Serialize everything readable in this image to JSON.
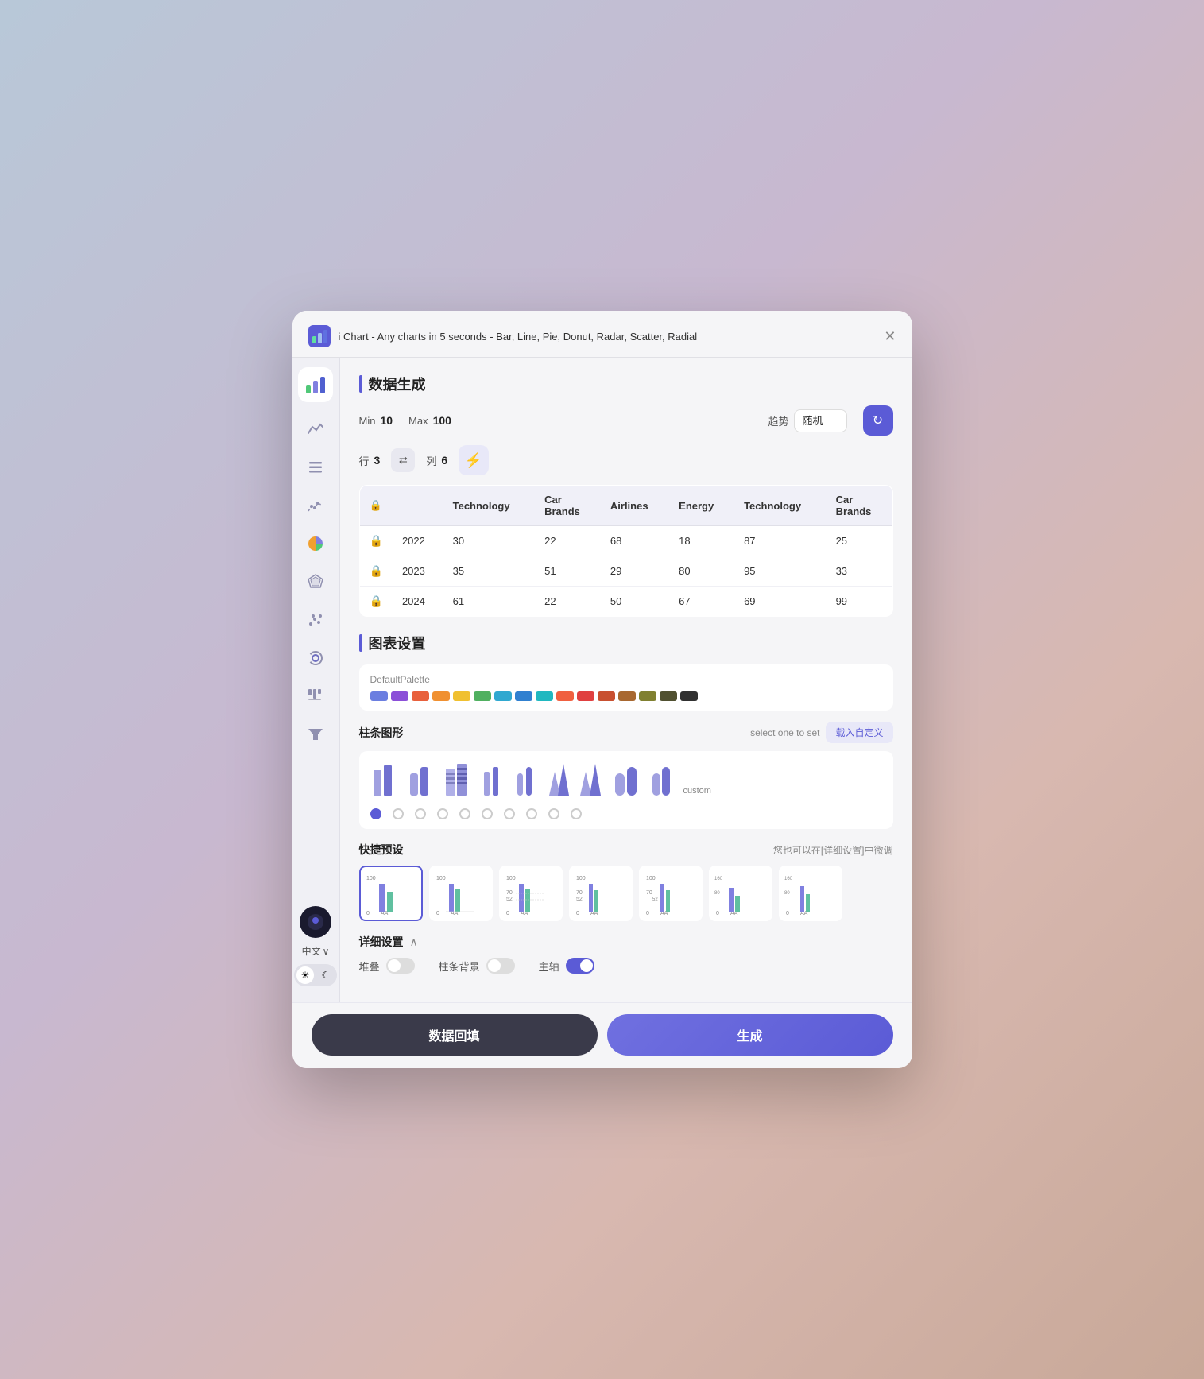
{
  "window": {
    "title": "i Chart - Any charts in 5 seconds - Bar, Line, Pie, Donut, Radar, Scatter, Radial",
    "close_label": "✕"
  },
  "sidebar": {
    "items": [
      {
        "icon": "📊",
        "name": "bar-chart"
      },
      {
        "icon": "〰",
        "name": "line-chart"
      },
      {
        "icon": "≡",
        "name": "list-chart"
      },
      {
        "icon": "⋯",
        "name": "scatter-chart"
      },
      {
        "icon": "◑",
        "name": "pie-chart"
      },
      {
        "icon": "⬡",
        "name": "radar-chart"
      },
      {
        "icon": "⋰",
        "name": "scatter2-chart"
      },
      {
        "icon": "◌",
        "name": "radial-chart"
      },
      {
        "icon": "⫶",
        "name": "grid-chart"
      },
      {
        "icon": "▽",
        "name": "funnel-chart"
      }
    ],
    "bottom": {
      "lang": "中文",
      "lang_arrow": "∨",
      "theme_sun": "☀",
      "theme_moon": "☾"
    }
  },
  "data_section": {
    "title": "数据生成",
    "min_label": "Min",
    "min_value": "10",
    "max_label": "Max",
    "max_value": "100",
    "trend_label": "趋势",
    "trend_value": "随机",
    "row_label": "行",
    "row_value": "3",
    "col_label": "列",
    "col_value": "6",
    "table": {
      "headers": [
        "",
        "",
        "Technology",
        "Car Brands",
        "Airlines",
        "Energy",
        "Technology",
        "Car Brands"
      ],
      "rows": [
        {
          "lock": "🔒",
          "year": "2022",
          "vals": [
            "30",
            "22",
            "68",
            "18",
            "87",
            "25"
          ]
        },
        {
          "lock": "🔒",
          "year": "2023",
          "vals": [
            "35",
            "51",
            "29",
            "80",
            "95",
            "33"
          ]
        },
        {
          "lock": "🔒",
          "year": "2024",
          "vals": [
            "61",
            "22",
            "50",
            "67",
            "69",
            "99"
          ]
        }
      ]
    }
  },
  "chart_section": {
    "title": "图表设置",
    "palette_name": "DefaultPalette",
    "palette_colors": [
      "#6b7ee0",
      "#8b4fd8",
      "#e8603c",
      "#f09030",
      "#f0c030",
      "#50b060",
      "#30a8d0",
      "#3080d0",
      "#20b8c0",
      "#f06040",
      "#e04040",
      "#c85030",
      "#a86830",
      "#808030",
      "#505030",
      "#303030"
    ],
    "bar_shape_label": "柱条图形",
    "select_hint": "select one to set",
    "custom_btn": "载入自定义",
    "preset_label": "快捷预设",
    "preset_hint": "您也可以在[详细设置]中微调",
    "detail_label": "详细设置",
    "detail_toggle": "∧",
    "detail_items": [
      {
        "label": "堆叠",
        "on": false
      },
      {
        "label": "柱条背景",
        "on": false
      },
      {
        "label": "主轴",
        "on": true
      }
    ]
  },
  "buttons": {
    "fill_label": "数据回填",
    "generate_label": "生成"
  }
}
